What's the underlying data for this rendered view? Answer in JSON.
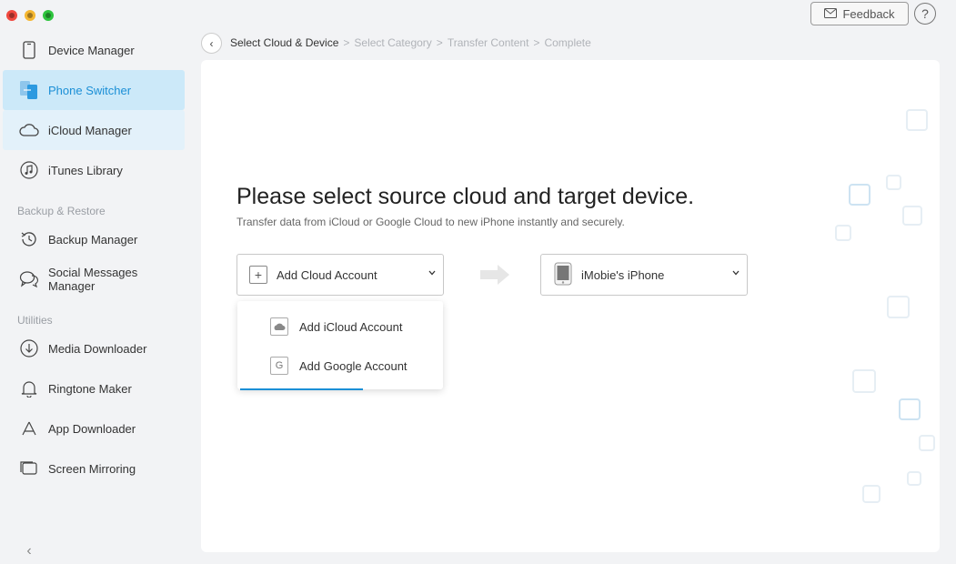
{
  "sidebar": {
    "items": [
      {
        "label": "Device Manager",
        "icon": "phone-outline-icon"
      },
      {
        "label": "Phone Switcher",
        "icon": "phone-switch-icon"
      },
      {
        "label": "iCloud Manager",
        "icon": "cloud-icon"
      },
      {
        "label": "iTunes Library",
        "icon": "music-note-icon"
      },
      {
        "label": "Backup Manager",
        "icon": "clock-history-icon"
      },
      {
        "label": "Social Messages Manager",
        "icon": "chat-bubbles-icon"
      },
      {
        "label": "Media Downloader",
        "icon": "download-circle-icon"
      },
      {
        "label": "Ringtone Maker",
        "icon": "bell-icon"
      },
      {
        "label": "App Downloader",
        "icon": "app-store-icon"
      },
      {
        "label": "Screen Mirroring",
        "icon": "screen-mirror-icon"
      }
    ],
    "sections": {
      "backup": "Backup & Restore",
      "utilities": "Utilities"
    },
    "collapse_glyph": "‹"
  },
  "header": {
    "feedback_label": "Feedback",
    "help_glyph": "?"
  },
  "breadcrumb": {
    "back_glyph": "‹",
    "steps": [
      "Select Cloud & Device",
      "Select Category",
      "Transfer Content",
      "Complete"
    ],
    "separator": ">"
  },
  "main": {
    "title": "Please select source cloud and target device.",
    "subtitle": "Transfer data from iCloud or Google Cloud to new iPhone instantly and securely.",
    "source": {
      "label": "Add Cloud Account",
      "plus_glyph": "+"
    },
    "target": {
      "label": "iMobie's iPhone"
    },
    "chevron": "⌄",
    "dropdown": [
      {
        "label": "Add iCloud Account",
        "icon": "cloud-icon"
      },
      {
        "label": "Add Google Account",
        "icon": "google-g-icon",
        "glyph": "G"
      }
    ]
  },
  "colors": {
    "accent": "#1b8fd6",
    "active_bg": "#cce9f9",
    "hover_bg": "#e3f1fa"
  }
}
